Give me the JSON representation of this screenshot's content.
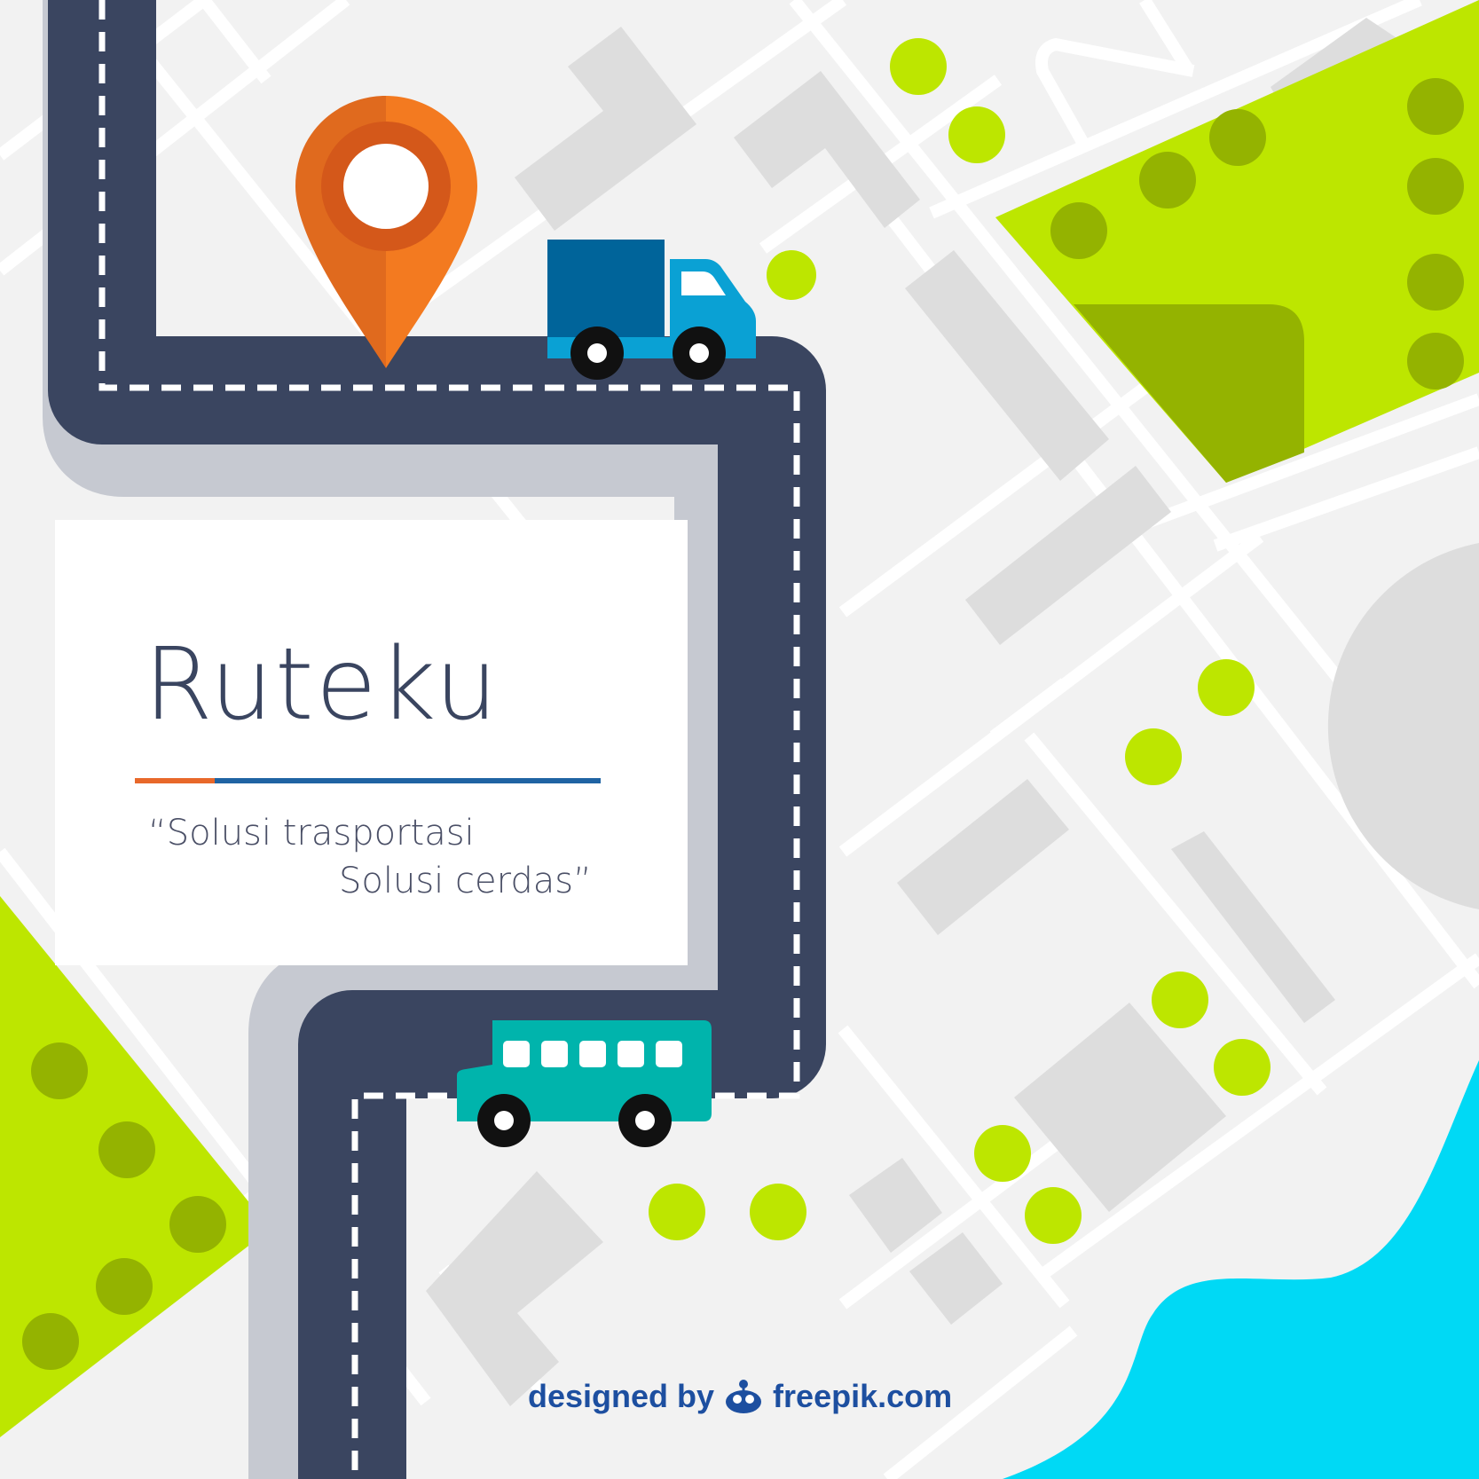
{
  "map": {
    "title": "Ruteku",
    "tagline_line1": "“Solusi trasportasi",
    "tagline_line2": "Solusi cerdas”",
    "credit_designed": "designed by",
    "credit_brand": "freepik.com"
  },
  "markers": {
    "destination": "location-pin-icon",
    "vehicles": [
      "truck-icon",
      "bus-icon"
    ]
  },
  "colors": {
    "background": "#f2f2f2",
    "street": "#ffffff",
    "building": "#dddddd",
    "park": "#bde600",
    "park_dark": "#94b300",
    "tree_light": "#bde600",
    "tree_dark": "#94b300",
    "water": "#00d9f5",
    "road": "#3a4560",
    "road_shadow": "#c6c9d1",
    "pin": "#f37a20",
    "truck_cargo": "#00649a",
    "truck_cab": "#0aa1d4",
    "bus": "#00b4ac"
  }
}
